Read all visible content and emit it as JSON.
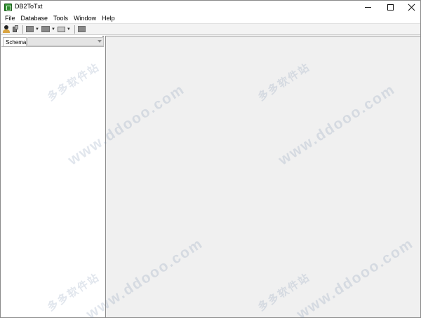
{
  "window": {
    "title": "DB2ToTxt",
    "controls": {
      "minimize_icon": "minimize-icon",
      "maximize_icon": "maximize-icon",
      "close_icon": "close-icon"
    }
  },
  "menubar": {
    "items": [
      {
        "label": "File"
      },
      {
        "label": "Database"
      },
      {
        "label": "Tools"
      },
      {
        "label": "Window"
      },
      {
        "label": "Help"
      }
    ]
  },
  "toolbar": {
    "buttons": [
      {
        "icon": "connect-user-icon"
      },
      {
        "icon": "disconnect-icon"
      },
      {
        "icon": "export-icon",
        "has_dropdown": true
      },
      {
        "icon": "table-icon",
        "has_dropdown": true
      },
      {
        "icon": "monitor-icon",
        "has_dropdown": true
      },
      {
        "icon": "stop-icon"
      }
    ],
    "dropdown_glyph": "▼"
  },
  "left_panel": {
    "tab_label": "Schema",
    "schema_selected": ""
  },
  "watermark": {
    "chinese": "多多软件站",
    "url": "www.ddooo.com"
  },
  "colors": {
    "workspace_bg": "#f0f0f0",
    "toolbar_bg": "#f3f3f3",
    "app_icon": "#2f8f2f"
  }
}
